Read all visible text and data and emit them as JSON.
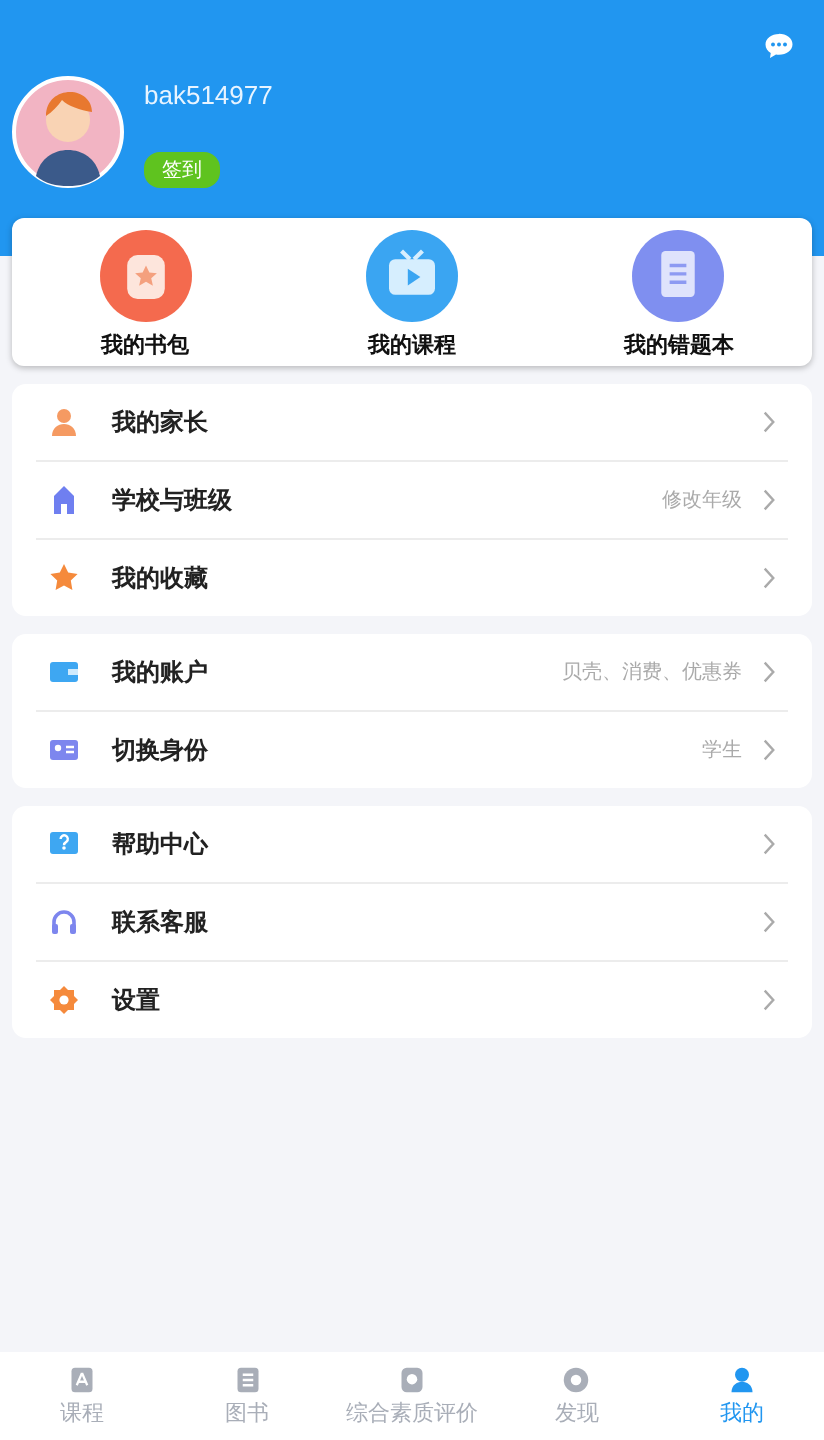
{
  "profile": {
    "username": "bak514977",
    "checkin": "签到"
  },
  "shortcuts": [
    {
      "label": "我的书包"
    },
    {
      "label": "我的课程"
    },
    {
      "label": "我的错题本"
    }
  ],
  "menu_groups": [
    {
      "items": [
        {
          "label": "我的家长"
        },
        {
          "label": "学校与班级",
          "detail": "修改年级"
        },
        {
          "label": "我的收藏"
        }
      ]
    },
    {
      "items": [
        {
          "label": "我的账户",
          "detail": "贝壳、消费、优惠券"
        },
        {
          "label": "切换身份",
          "detail": "学生"
        }
      ]
    },
    {
      "items": [
        {
          "label": "帮助中心"
        },
        {
          "label": "联系客服"
        },
        {
          "label": "设置"
        }
      ]
    }
  ],
  "tabs": [
    {
      "label": "课程",
      "selected": false
    },
    {
      "label": "图书",
      "selected": false
    },
    {
      "label": "综合素质评价",
      "selected": false
    },
    {
      "label": "发现",
      "selected": false
    },
    {
      "label": "我的",
      "selected": true
    }
  ]
}
